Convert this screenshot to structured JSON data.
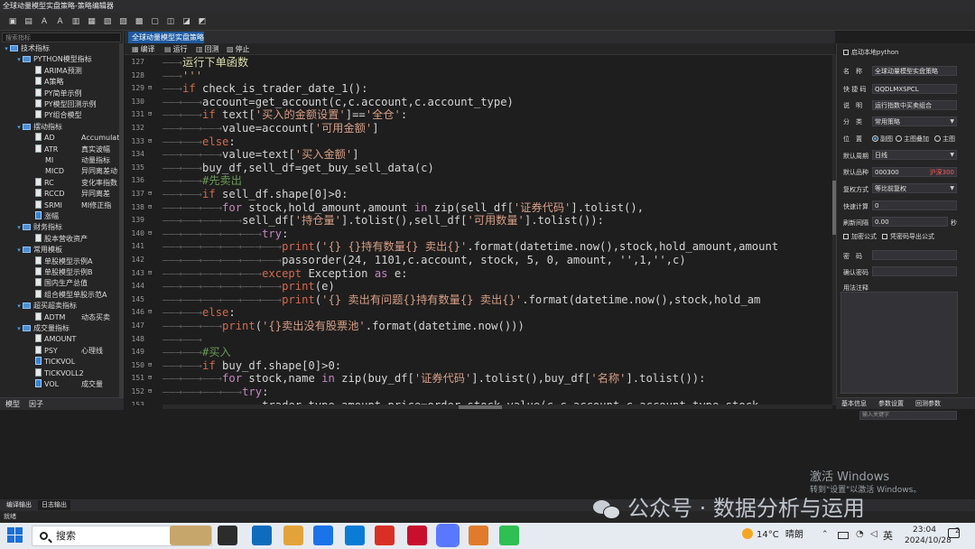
{
  "window": {
    "title": "全球动量模型实盘策略-策略编辑器"
  },
  "toolbar": {
    "icons": [
      "save-icon",
      "save-as-icon",
      "font-decrease-icon",
      "font-increase-icon",
      "comment-icon",
      "uncomment-icon",
      "indent-icon",
      "outdent-icon",
      "find-icon",
      "replace-icon",
      "export-icon",
      "import-icon",
      "help-icon"
    ]
  },
  "left_panel": {
    "search_placeholder": "搜索指标",
    "tree": [
      {
        "level": 0,
        "arrow": "▾",
        "icon": "folder",
        "label": "技术指标",
        "desc": ""
      },
      {
        "level": 1,
        "arrow": "▾",
        "icon": "folder",
        "label": "PYTHON模型指标",
        "desc": ""
      },
      {
        "level": 2,
        "arrow": "",
        "icon": "file",
        "label": "ARIMA预测",
        "desc": ""
      },
      {
        "level": 2,
        "arrow": "",
        "icon": "file",
        "label": "A策略",
        "desc": ""
      },
      {
        "level": 2,
        "arrow": "",
        "icon": "file",
        "label": "PY简单示例",
        "desc": ""
      },
      {
        "level": 2,
        "arrow": "",
        "icon": "file",
        "label": "PY模型回测示例",
        "desc": ""
      },
      {
        "level": 2,
        "arrow": "",
        "icon": "file",
        "label": "PY组合模型",
        "desc": ""
      },
      {
        "level": 1,
        "arrow": "▾",
        "icon": "folder",
        "label": "摆动指标",
        "desc": ""
      },
      {
        "level": 2,
        "arrow": "",
        "icon": "file",
        "label": "AD",
        "desc": "Accumulat"
      },
      {
        "level": 2,
        "arrow": "",
        "icon": "file",
        "label": "ATR",
        "desc": "真实波幅"
      },
      {
        "level": 2,
        "arrow": "",
        "icon": "none",
        "label": "MI",
        "desc": "动量指标"
      },
      {
        "level": 2,
        "arrow": "",
        "icon": "none",
        "label": "MICD",
        "desc": "异同离差动"
      },
      {
        "level": 2,
        "arrow": "",
        "icon": "file",
        "label": "RC",
        "desc": "变化率指数"
      },
      {
        "level": 2,
        "arrow": "",
        "icon": "file",
        "label": "RCCD",
        "desc": "异同离差"
      },
      {
        "level": 2,
        "arrow": "",
        "icon": "file",
        "label": "SRMI",
        "desc": "MI修正指"
      },
      {
        "level": 2,
        "arrow": "",
        "icon": "fileb",
        "label": "涨幅",
        "desc": ""
      },
      {
        "level": 1,
        "arrow": "▾",
        "icon": "folder",
        "label": "财务指标",
        "desc": ""
      },
      {
        "level": 2,
        "arrow": "",
        "icon": "file",
        "label": "股本营收资产",
        "desc": ""
      },
      {
        "level": 1,
        "arrow": "▾",
        "icon": "folder",
        "label": "常用模板",
        "desc": ""
      },
      {
        "level": 2,
        "arrow": "",
        "icon": "file",
        "label": "单股模型示例A",
        "desc": ""
      },
      {
        "level": 2,
        "arrow": "",
        "icon": "file",
        "label": "单股模型示例B",
        "desc": ""
      },
      {
        "level": 2,
        "arrow": "",
        "icon": "file",
        "label": "国内生产总值",
        "desc": ""
      },
      {
        "level": 2,
        "arrow": "",
        "icon": "file",
        "label": "组合模型单股示范A",
        "desc": ""
      },
      {
        "level": 1,
        "arrow": "▾",
        "icon": "folder",
        "label": "超买超卖指标",
        "desc": ""
      },
      {
        "level": 2,
        "arrow": "",
        "icon": "file",
        "label": "ADTM",
        "desc": "动态买卖"
      },
      {
        "level": 1,
        "arrow": "▾",
        "icon": "folder",
        "label": "成交量指标",
        "desc": ""
      },
      {
        "level": 2,
        "arrow": "",
        "icon": "file",
        "label": "AMOUNT",
        "desc": ""
      },
      {
        "level": 2,
        "arrow": "",
        "icon": "file",
        "label": "PSY",
        "desc": "心理线"
      },
      {
        "level": 2,
        "arrow": "",
        "icon": "fileb",
        "label": "TICKVOL",
        "desc": ""
      },
      {
        "level": 2,
        "arrow": "",
        "icon": "file",
        "label": "TICKVOLL2",
        "desc": ""
      },
      {
        "level": 2,
        "arrow": "",
        "icon": "fileb",
        "label": "VOL",
        "desc": "成交量"
      }
    ],
    "tabs": [
      "模型",
      "因子"
    ]
  },
  "editor": {
    "tab_title": "全球动量模型实盘策略",
    "toolbar": [
      {
        "icon": "compile-icon",
        "label": "编译"
      },
      {
        "icon": "run-icon",
        "label": "运行"
      },
      {
        "icon": "backtest-icon",
        "label": "回测"
      },
      {
        "icon": "stop-icon",
        "label": "停止"
      }
    ],
    "lines": [
      {
        "n": "127",
        "fold": "",
        "segs": [
          [
            "arr",
            "——→"
          ],
          [
            "tx",
            "运行下单函数"
          ]
        ]
      },
      {
        "n": "128",
        "fold": "",
        "segs": [
          [
            "arr",
            "——→"
          ],
          [
            "s",
            "'''"
          ]
        ]
      },
      {
        "n": "129",
        "fold": "⊟",
        "segs": [
          [
            "arr",
            "——→"
          ],
          [
            "kb",
            "if "
          ],
          [
            "w",
            "check_is_trader_date_1():"
          ]
        ]
      },
      {
        "n": "130",
        "fold": "",
        "segs": [
          [
            "arr",
            "——→——→"
          ],
          [
            "w",
            "account=get_account(c,c.account,c.account_type)"
          ]
        ]
      },
      {
        "n": "131",
        "fold": "⊟",
        "segs": [
          [
            "arr",
            "——→——→"
          ],
          [
            "kb",
            "if "
          ],
          [
            "w",
            "text["
          ],
          [
            "s",
            "'买入的金额设置'"
          ],
          [
            "w",
            "]=="
          ],
          [
            "s",
            "'全仓'"
          ],
          [
            "w",
            ":"
          ]
        ]
      },
      {
        "n": "132",
        "fold": "",
        "segs": [
          [
            "arr",
            "——→——→——→"
          ],
          [
            "w",
            "value=account["
          ],
          [
            "s",
            "'可用金额'"
          ],
          [
            "w",
            "]"
          ]
        ]
      },
      {
        "n": "133",
        "fold": "⊟",
        "segs": [
          [
            "arr",
            "——→——→"
          ],
          [
            "kb",
            "else"
          ],
          [
            "w",
            ":"
          ]
        ]
      },
      {
        "n": "134",
        "fold": "",
        "segs": [
          [
            "arr",
            "——→——→——→"
          ],
          [
            "w",
            "value=text["
          ],
          [
            "s",
            "'买入金额'"
          ],
          [
            "w",
            "]"
          ]
        ]
      },
      {
        "n": "135",
        "fold": "",
        "segs": [
          [
            "arr",
            "——→——→"
          ],
          [
            "w",
            "buy_df,sell_df=get_buy_sell_data(c)"
          ]
        ]
      },
      {
        "n": "136",
        "fold": "",
        "segs": [
          [
            "arr",
            "——→——→"
          ],
          [
            "cm",
            "#先卖出"
          ]
        ]
      },
      {
        "n": "137",
        "fold": "⊟",
        "segs": [
          [
            "arr",
            "——→——→"
          ],
          [
            "kb",
            "if "
          ],
          [
            "w",
            "sell_df.shape[0]>0:"
          ]
        ]
      },
      {
        "n": "138",
        "fold": "⊟",
        "segs": [
          [
            "arr",
            "——→——→——→"
          ],
          [
            "k",
            "for "
          ],
          [
            "w",
            "stock,hold_amount,amount "
          ],
          [
            "k",
            "in "
          ],
          [
            "w",
            "zip(sell_df["
          ],
          [
            "s",
            "'证券代码'"
          ],
          [
            "w",
            "].tolist(),"
          ]
        ]
      },
      {
        "n": "139",
        "fold": "",
        "segs": [
          [
            "arr",
            "——→——→——→——→"
          ],
          [
            "w",
            "sell_df["
          ],
          [
            "s",
            "'持仓量'"
          ],
          [
            "w",
            "].tolist(),sell_df["
          ],
          [
            "s",
            "'可用数量'"
          ],
          [
            "w",
            "].tolist()):"
          ]
        ]
      },
      {
        "n": "140",
        "fold": "⊟",
        "segs": [
          [
            "arr",
            "——→——→——→——→——→"
          ],
          [
            "k",
            "try"
          ],
          [
            "w",
            ":"
          ]
        ]
      },
      {
        "n": "141",
        "fold": "",
        "segs": [
          [
            "arr",
            "——→——→——→——→——→——→"
          ],
          [
            "kb",
            "print"
          ],
          [
            "w",
            "("
          ],
          [
            "s",
            "'{} {}持有数量{} 卖出{}'"
          ],
          [
            "w",
            ".format(datetime.now(),stock,hold_amount,amount"
          ]
        ]
      },
      {
        "n": "142",
        "fold": "",
        "segs": [
          [
            "arr",
            "——→——→——→——→——→——→"
          ],
          [
            "w",
            "passorder(24, 1101,c.account, stock, 5, 0, amount, '',1,'',c)"
          ]
        ]
      },
      {
        "n": "143",
        "fold": "⊟",
        "segs": [
          [
            "arr",
            "——→——→——→——→——→"
          ],
          [
            "kb",
            "except "
          ],
          [
            "w",
            "Exception "
          ],
          [
            "k",
            "as "
          ],
          [
            "w",
            "e:"
          ]
        ]
      },
      {
        "n": "144",
        "fold": "",
        "segs": [
          [
            "arr",
            "——→——→——→——→——→——→"
          ],
          [
            "kb",
            "print"
          ],
          [
            "w",
            "(e)"
          ]
        ]
      },
      {
        "n": "145",
        "fold": "",
        "segs": [
          [
            "arr",
            "——→——→——→——→——→——→"
          ],
          [
            "kb",
            "print"
          ],
          [
            "w",
            "("
          ],
          [
            "s",
            "'{} 卖出有问题{}持有数量{} 卖出{}'"
          ],
          [
            "w",
            ".format(datetime.now(),stock,hold_am"
          ]
        ]
      },
      {
        "n": "146",
        "fold": "⊟",
        "segs": [
          [
            "arr",
            "——→——→"
          ],
          [
            "kb",
            "else"
          ],
          [
            "w",
            ":"
          ]
        ]
      },
      {
        "n": "147",
        "fold": "",
        "segs": [
          [
            "arr",
            "——→——→——→"
          ],
          [
            "kb",
            "print"
          ],
          [
            "w",
            "("
          ],
          [
            "s",
            "'{}卖出没有股票池'"
          ],
          [
            "w",
            ".format(datetime.now()))"
          ]
        ]
      },
      {
        "n": "148",
        "fold": "",
        "segs": [
          [
            "arr",
            "——→——→"
          ]
        ]
      },
      {
        "n": "149",
        "fold": "",
        "segs": [
          [
            "arr",
            "——→——→"
          ],
          [
            "cm",
            "#买入"
          ]
        ]
      },
      {
        "n": "150",
        "fold": "⊟",
        "segs": [
          [
            "arr",
            "——→——→"
          ],
          [
            "kb",
            "if "
          ],
          [
            "w",
            "buy_df.shape[0]>0:"
          ]
        ]
      },
      {
        "n": "151",
        "fold": "⊟",
        "segs": [
          [
            "arr",
            "——→——→——→"
          ],
          [
            "k",
            "for "
          ],
          [
            "w",
            "stock,name "
          ],
          [
            "k",
            "in "
          ],
          [
            "w",
            "zip(buy_df["
          ],
          [
            "s",
            "'证券代码'"
          ],
          [
            "w",
            "].tolist(),buy_df["
          ],
          [
            "s",
            "'名称'"
          ],
          [
            "w",
            "].tolist()):"
          ]
        ]
      },
      {
        "n": "152",
        "fold": "⊟",
        "segs": [
          [
            "arr",
            "——→——→——→——→"
          ],
          [
            "k",
            "try"
          ],
          [
            "w",
            ":"
          ]
        ]
      },
      {
        "n": "153",
        "fold": "",
        "segs": [
          [
            "arr",
            "——→——→——→——→——→"
          ],
          [
            "w",
            "trader_type,amount,price=order_stock_value(c,c.account,c.account_type,stock"
          ]
        ]
      }
    ]
  },
  "right_panel": {
    "enable_python": "启动本地python",
    "fields": [
      {
        "key": "name",
        "label": "名　称",
        "value": "全球动量模型实盘策略",
        "dropdown": false
      },
      {
        "key": "shortcut",
        "label": "快 捷 码",
        "value": "QQDLMXSPCL",
        "dropdown": false
      },
      {
        "key": "desc",
        "label": "说　明",
        "value": "运行指数中买卖组合",
        "dropdown": false
      },
      {
        "key": "category",
        "label": "分　类",
        "value": "常用策略",
        "dropdown": true
      }
    ],
    "position_label": "位　置",
    "position_options": [
      "副图",
      "主图叠加",
      "主图"
    ],
    "position_selected": "副图",
    "period_label": "默认周期",
    "period_value": "日线",
    "stock_label": "默认品种",
    "stock_value": "000300",
    "stock_badge": "沪深300",
    "rights_label": "复权方式",
    "rights_value": "等比前复权",
    "fast_label": "快速计算",
    "fast_value": "0",
    "refresh_label": "刷新间隔",
    "refresh_value": "0.00",
    "refresh_unit": "秒",
    "encrypt_label": "加密公式",
    "export_label": "凭密码导出公式",
    "password_label": "密　码",
    "confirm_label": "确认密码",
    "notes_label": "用法注释",
    "tabs": [
      "基本信息",
      "参数设置",
      "回测参数"
    ],
    "search_placeholder": "输入关键字"
  },
  "output": {
    "tabs": [
      "编译输出",
      "日志输出"
    ]
  },
  "status": {
    "text": "就绪"
  },
  "taskbar": {
    "search_text": "搜索",
    "weather_temp": "14°C",
    "weather_text": "晴朗",
    "ime": "英",
    "time": "23:04",
    "date": "2024/10/28",
    "notification_count": "2",
    "app_colors": [
      "#c7a66b",
      "#2c2c2c",
      "#0f6cbd",
      "#e2a33a",
      "#1a73e8",
      "#0a7cd6",
      "#d93025",
      "#c8102e",
      "#5a78ff",
      "#e07b2c",
      "#2fbf53",
      "#1f9e55"
    ]
  },
  "overlay": {
    "activate_title": "激活 Windows",
    "activate_sub": "转到\"设置\"以激活 Windows。",
    "watermark": "公众号 · 数据分析与运用"
  }
}
